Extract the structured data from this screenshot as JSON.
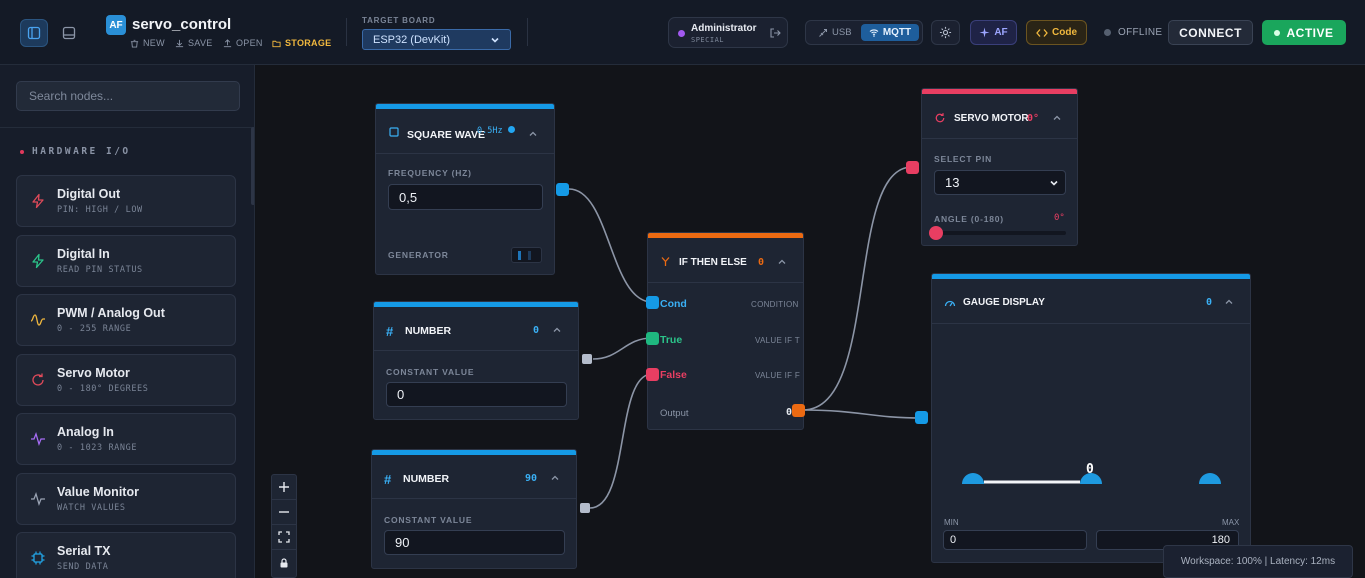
{
  "header": {
    "logo_text": "AF",
    "project_title": "servo_control",
    "file_actions": [
      {
        "label": "NEW",
        "icon": "trash-icon"
      },
      {
        "label": "SAVE",
        "icon": "download-icon"
      },
      {
        "label": "OPEN",
        "icon": "upload-icon"
      },
      {
        "label": "STORAGE",
        "icon": "folder-icon"
      }
    ],
    "target_board_label": "TARGET BOARD",
    "target_board_value": "ESP32 (DevKit)",
    "user_name": "Administrator",
    "user_role": "SPECIAL",
    "usb_label": "USB",
    "mqtt_label": "MQTT",
    "af_label": "AF",
    "code_label": "Code",
    "status_text": "OFFLINE",
    "connect_label": "CONNECT",
    "active_label": "ACTIVE",
    "colors": {
      "accent": "#1aa65c",
      "mqtt": "#1e5e9c",
      "code": "#f1b83e"
    }
  },
  "sidebar": {
    "search_placeholder": "Search nodes...",
    "category": "HARDWARE I/O",
    "items": [
      {
        "name": "Digital Out",
        "desc": "PIN: HIGH / LOW",
        "icon": "lightning-icon",
        "color": "#e04a5a"
      },
      {
        "name": "Digital In",
        "desc": "READ PIN STATUS",
        "icon": "lightning-icon",
        "color": "#2bc48a"
      },
      {
        "name": "PWM / Analog Out",
        "desc": "0 - 255 RANGE",
        "icon": "wave-icon",
        "color": "#f1b83e"
      },
      {
        "name": "Servo Motor",
        "desc": "0 - 180° DEGREES",
        "icon": "rotate-icon",
        "color": "#e04a5a"
      },
      {
        "name": "Analog In",
        "desc": "0 - 1023 RANGE",
        "icon": "pulse-icon",
        "color": "#a66cf5"
      },
      {
        "name": "Value Monitor",
        "desc": "WATCH VALUES",
        "icon": "pulse-icon",
        "color": "#9aa3b3"
      },
      {
        "name": "Serial TX",
        "desc": "SEND DATA",
        "icon": "chip-icon",
        "color": "#22a6e8"
      }
    ]
  },
  "nodes": {
    "square_wave": {
      "title": "SQUARE WAVE",
      "value": "0.5Hz",
      "freq_label": "FREQUENCY (HZ)",
      "freq_value": "0,5",
      "generator_label": "GENERATOR"
    },
    "number1": {
      "title": "NUMBER",
      "value": "0",
      "const_label": "CONSTANT VALUE",
      "const_value": "0"
    },
    "number2": {
      "title": "NUMBER",
      "value": "90",
      "const_label": "CONSTANT VALUE",
      "const_value": "90"
    },
    "ifelse": {
      "title": "IF THEN ELSE",
      "value": "0",
      "cond": "Cond",
      "cond_desc": "CONDITION",
      "true": "True",
      "true_desc": "VALUE IF T",
      "false": "False",
      "false_desc": "VALUE IF F",
      "output": "Output",
      "output_value": "0"
    },
    "servo": {
      "title": "SERVO MOTOR",
      "value": "0°",
      "pin_label": "SELECT PIN",
      "pin_value": "13",
      "angle_label": "ANGLE (0-180)",
      "angle_value": "0°",
      "angle_level": 0
    },
    "gauge": {
      "title": "GAUGE DISPLAY",
      "value": "0",
      "gauge_value": "0",
      "min_label": "MIN",
      "max_label": "MAX",
      "min_value": "0",
      "max_value": "180"
    }
  },
  "status_bar": "Workspace: 100% | Latency: 12ms"
}
